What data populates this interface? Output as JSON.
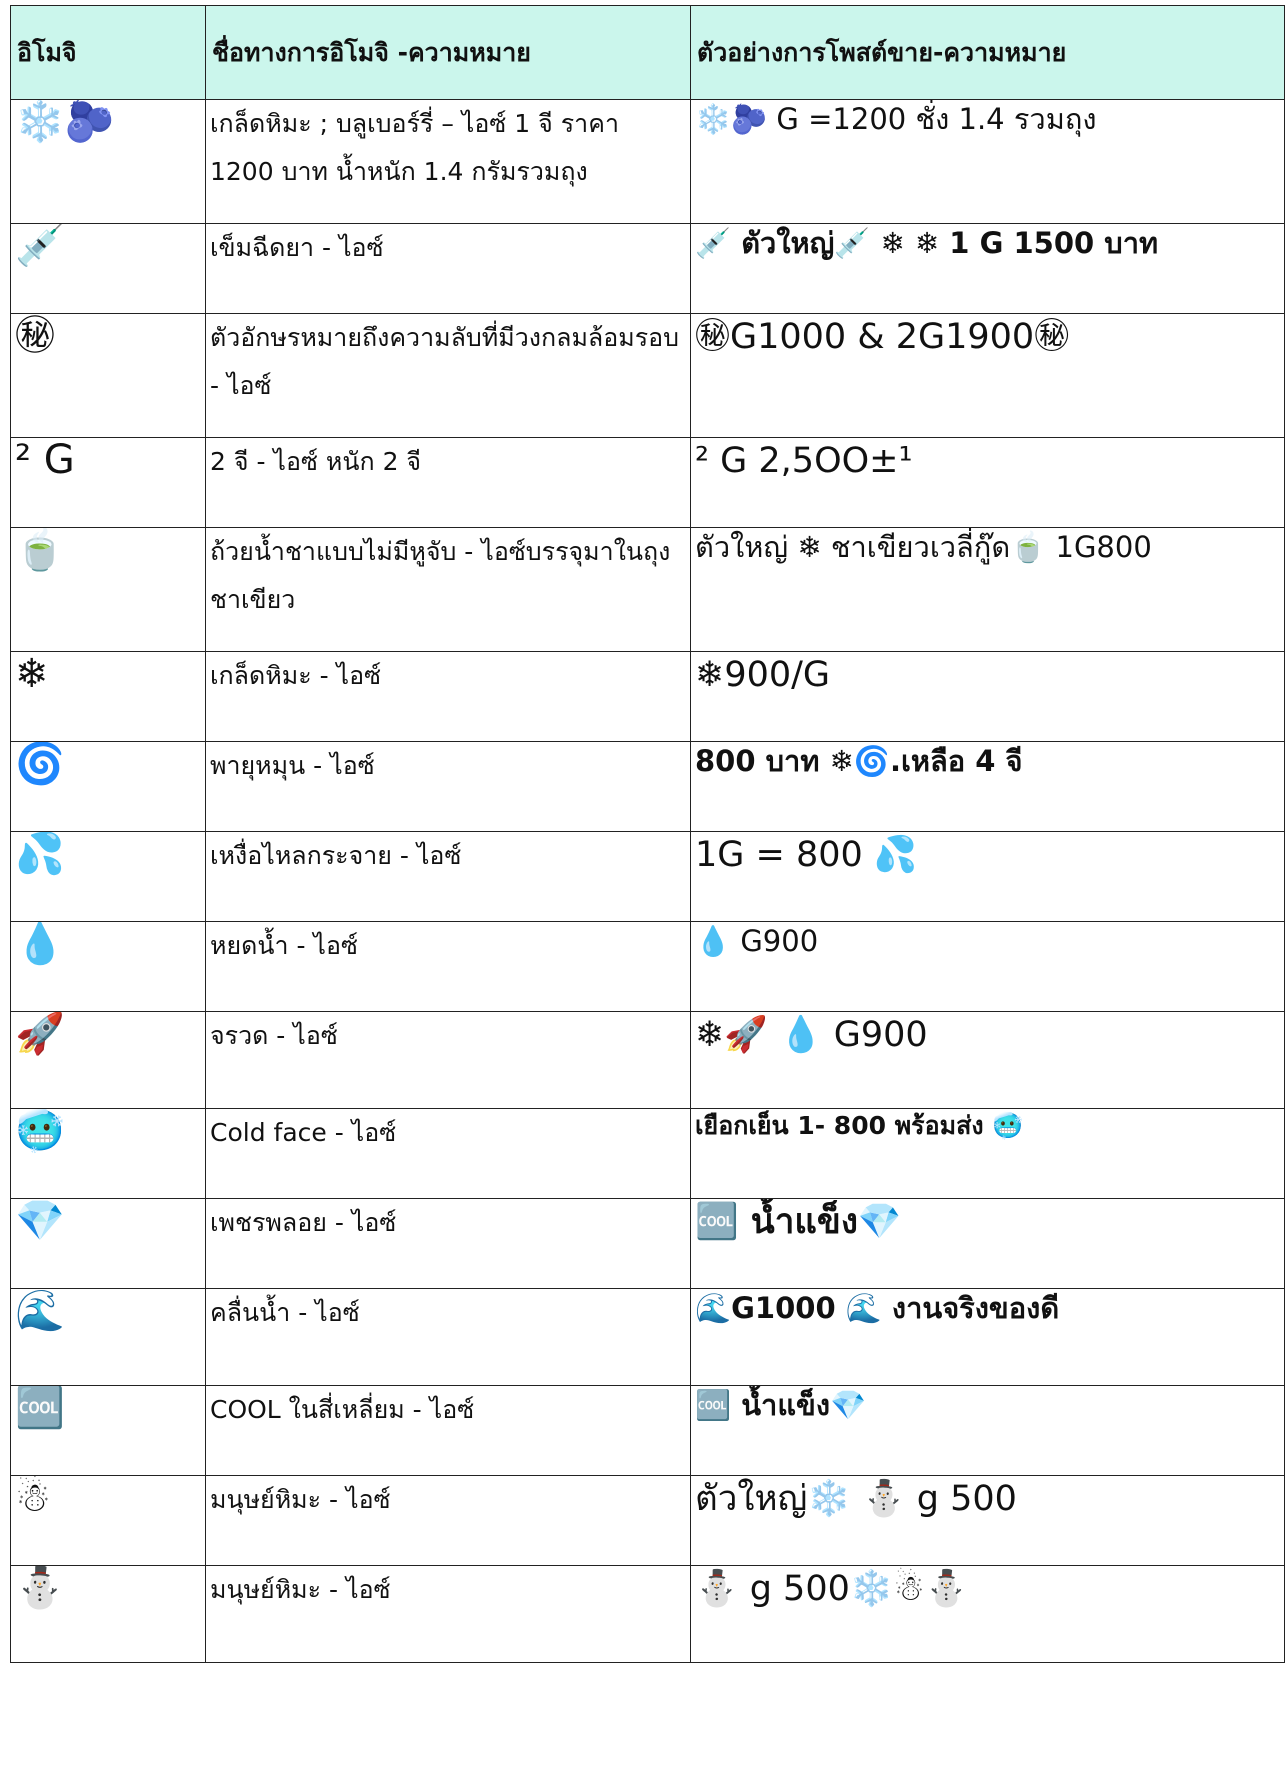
{
  "table": {
    "headers": [
      "อิโมจิ",
      "ชื่อทางการอิโมจิ -ความหมาย",
      "ตัวอย่างการโพสต์ขาย-ความหมาย"
    ],
    "rows": [
      {
        "emoji": "❄️🫐",
        "name": "เกล็ดหิมะ ; บลูเบอร์รี่ – ไอซ์ 1 จี ราคา 1200 บาท น้ำหนัก 1.4 กรัมรวมถุง",
        "example": "❄️🫐 G =1200 ชั่ง 1.4 รวมถุง"
      },
      {
        "emoji": "💉",
        "name": "เข็มฉีดยา - ไอซ์",
        "example": "💉 ตัวใหญ่💉 ❄ ❄ 1 G 1500 บาท"
      },
      {
        "emoji": "㊙",
        "name": "ตัวอักษรหมายถึงความลับที่มีวงกลมล้อมรอบ - ไอซ์",
        "example": "㊙G1000 & 2G1900㊙"
      },
      {
        "emoji": "² G",
        "name": "2 จี - ไอซ์ หนัก 2 จี",
        "example": "² G 2,5OO±¹"
      },
      {
        "emoji": "🍵",
        "name": "ถ้วยน้ำชาแบบไม่มีหูจับ - ไอซ์บรรจุมาในถุงชาเขียว",
        "example": "ตัวใหญ่ ❄ ชาเขียวเวลี่กู๊ด🍵 1G800"
      },
      {
        "emoji": "❄",
        "name": "เกล็ดหิมะ - ไอซ์",
        "example": "❄900/G"
      },
      {
        "emoji": "🌀",
        "name": "พายุหมุน - ไอซ์",
        "example": "800 บาท ❄🌀.เหลือ 4 จี"
      },
      {
        "emoji": "💦",
        "name": "เหงื่อไหลกระจาย - ไอซ์",
        "example": "1G = 800 💦"
      },
      {
        "emoji": "💧",
        "name": "หยดน้ำ - ไอซ์",
        "example": "💧 G900"
      },
      {
        "emoji": "🚀",
        "name": "จรวด - ไอซ์",
        "example": "❄🚀 💧 G900"
      },
      {
        "emoji": "🥶",
        "name": "Cold face - ไอซ์",
        "example": "เยือกเย็น 1- 800 พร้อมส่ง 🥶"
      },
      {
        "emoji": "💎",
        "name": "เพชรพลอย - ไอซ์",
        "example": "🆒 น้ำแข็ง💎"
      },
      {
        "emoji": "🌊",
        "name": "คลื่นน้ำ - ไอซ์",
        "example": "🌊G1000 🌊 งานจริงของดี"
      },
      {
        "emoji": "🆒",
        "name": "COOL ในสี่เหลี่ยม - ไอซ์",
        "example": "🆒 น้ำแข็ง💎"
      },
      {
        "emoji": "☃",
        "name": "มนุษย์หิมะ - ไอซ์",
        "example": "ตัวใหญ่❄️ ⛄ g 500"
      },
      {
        "emoji": "⛄",
        "name": "มนุษย์หิมะ - ไอซ์",
        "example": "⛄ g 500❄️☃⛄"
      }
    ]
  }
}
